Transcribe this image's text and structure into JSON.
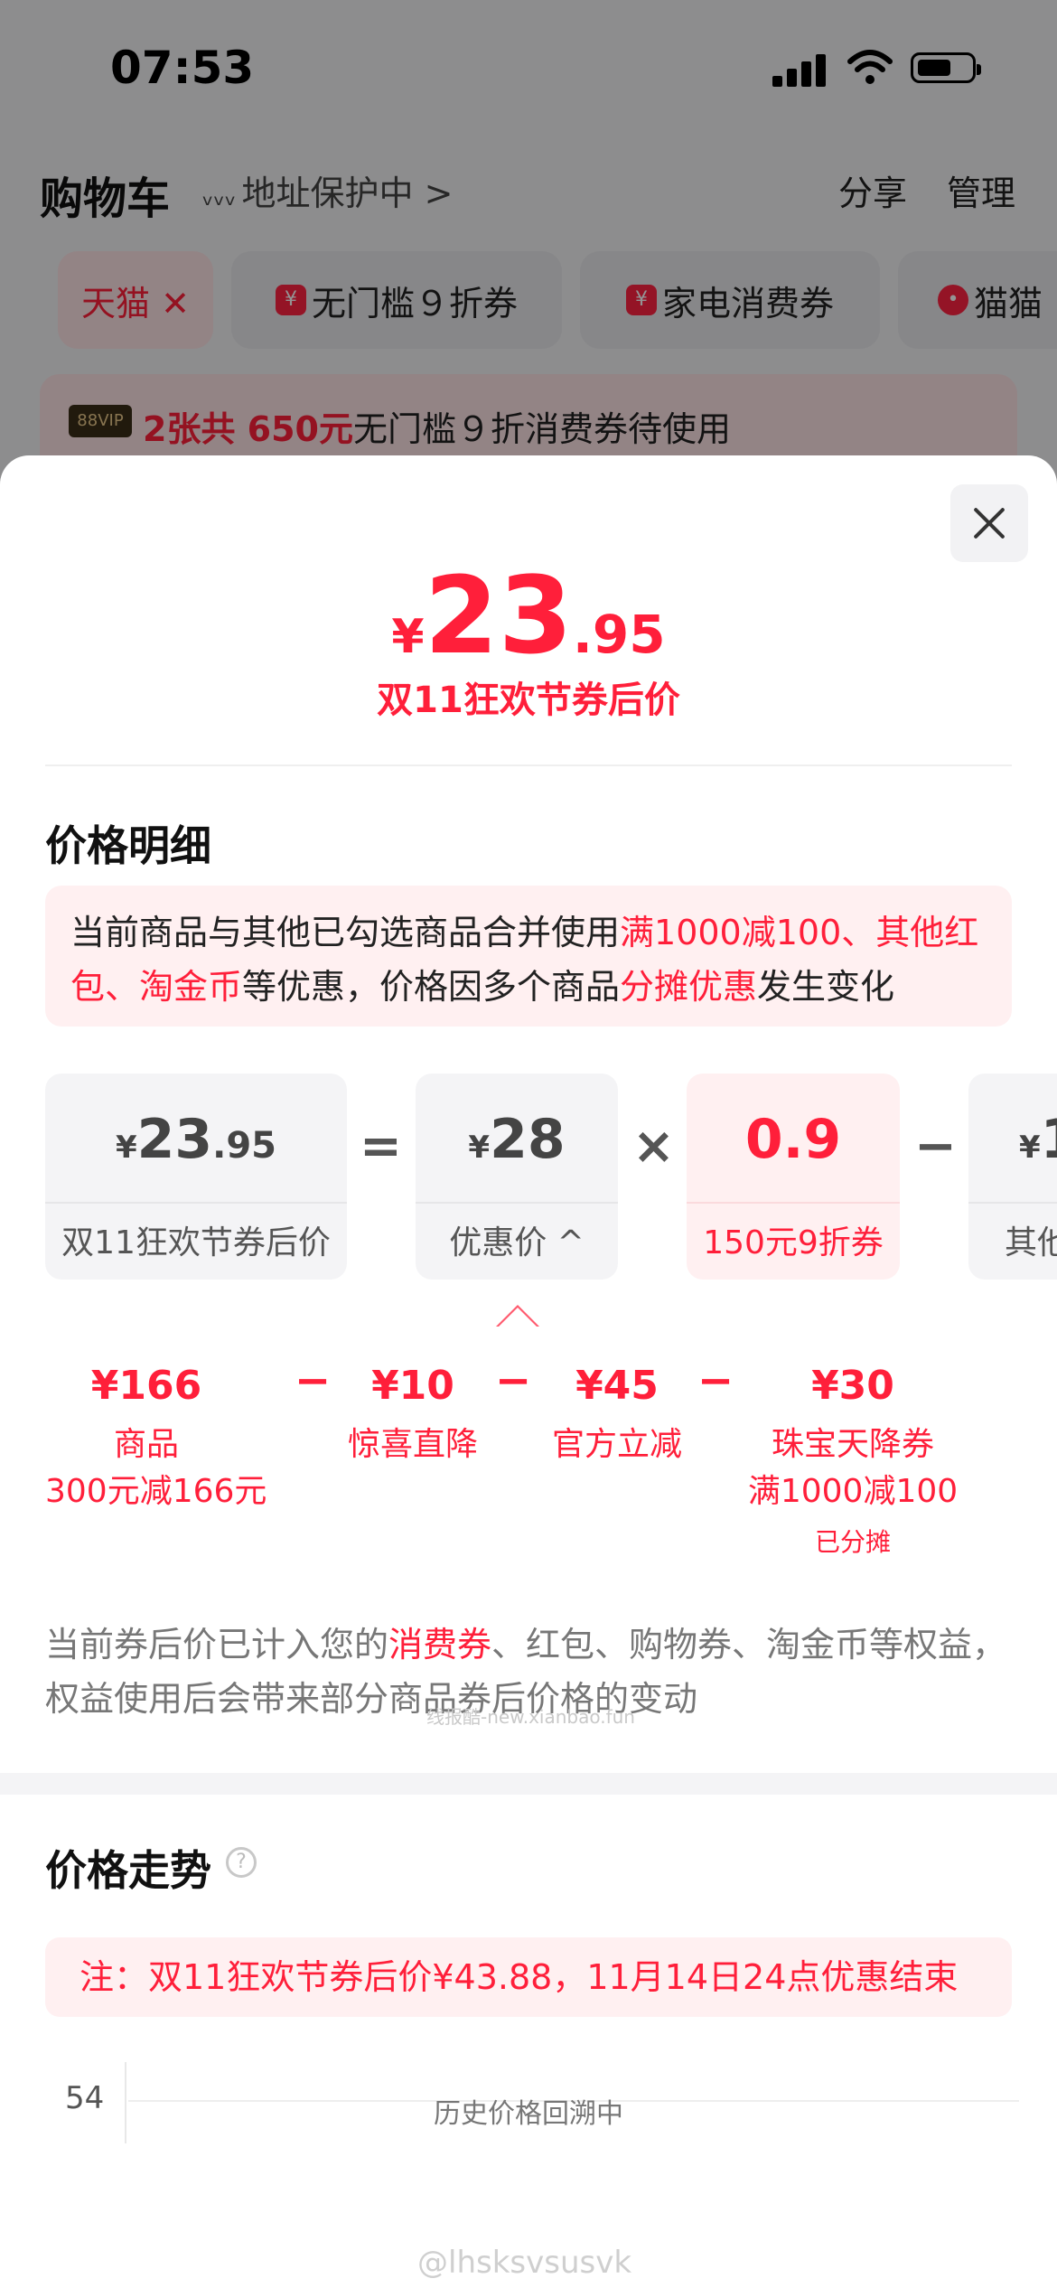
{
  "status_bar": {
    "time": "07:53"
  },
  "background": {
    "title": "购物车",
    "address_text": "地址保护中 >",
    "eye_icon_glyph": "ᵥᵥᵥ",
    "share": "分享",
    "manage": "管理",
    "chips": [
      {
        "label": "天猫 ✕",
        "active": true
      },
      {
        "label": "无门槛９折券",
        "icon": "¥"
      },
      {
        "label": "家电消费券",
        "icon": "¥"
      },
      {
        "label": "猫猫",
        "icon": "•"
      }
    ],
    "vip_badge": "88VIP",
    "vip_red": "2张共 650元",
    "vip_rest": "无门槛９折消费券待使用"
  },
  "sheet": {
    "price": {
      "currency": "¥",
      "integer": "23",
      "decimal": ".95"
    },
    "price_caption": "双11狂欢节券后价",
    "detail_title": "价格明细",
    "notice": {
      "p1": "当前商品与其他已勾选商品合并使用",
      "r1": "满1000减100、其他红包、淘金币",
      "p2": "等优惠，价格因多个商品",
      "r2": "分摊优惠",
      "p3": "发生变化"
    },
    "formula": [
      {
        "cur": "¥",
        "int": "23",
        "dec": ".95",
        "label": "双11狂欢节券后价"
      },
      {
        "op": "="
      },
      {
        "cur": "¥",
        "int": "28",
        "dec": "",
        "label": "优惠价 ^"
      },
      {
        "op": "×"
      },
      {
        "cur": "",
        "int": "0.9",
        "dec": "",
        "label": "150元9折券",
        "highlight": true
      },
      {
        "op": "−"
      },
      {
        "cur": "¥",
        "int": "1",
        "dec": "",
        "label": "其他"
      }
    ],
    "breakdown": [
      {
        "amount": "¥166",
        "name": "商品",
        "sub": "300元减166元"
      },
      {
        "op": "−"
      },
      {
        "amount": "¥10",
        "name": "惊喜直降"
      },
      {
        "op": "−"
      },
      {
        "amount": "¥45",
        "name": "官方立减"
      },
      {
        "op": "−"
      },
      {
        "amount": "¥30",
        "name": "珠宝天降券",
        "sub": "满1000减100",
        "tag": "已分摊"
      }
    ],
    "footnote": {
      "p1": "当前券后价已计入您的",
      "r1": "消费券",
      "p2": "、红包、购物券、淘金币等权益，权益使用后会带来部分商品券后价格的变动"
    },
    "watermark_small": "线报酷-new.xianbao.fun",
    "trend_title": "价格走势",
    "help_icon_glyph": "?",
    "trend_note": "注：双11狂欢节券后价¥43.88，11月14日24点优惠结束",
    "chart_data": {
      "type": "line",
      "y_ticks": [
        "54"
      ],
      "status_text": "历史价格回溯中",
      "series": []
    },
    "watermark_bottom": "@lhsksvsusvk"
  }
}
